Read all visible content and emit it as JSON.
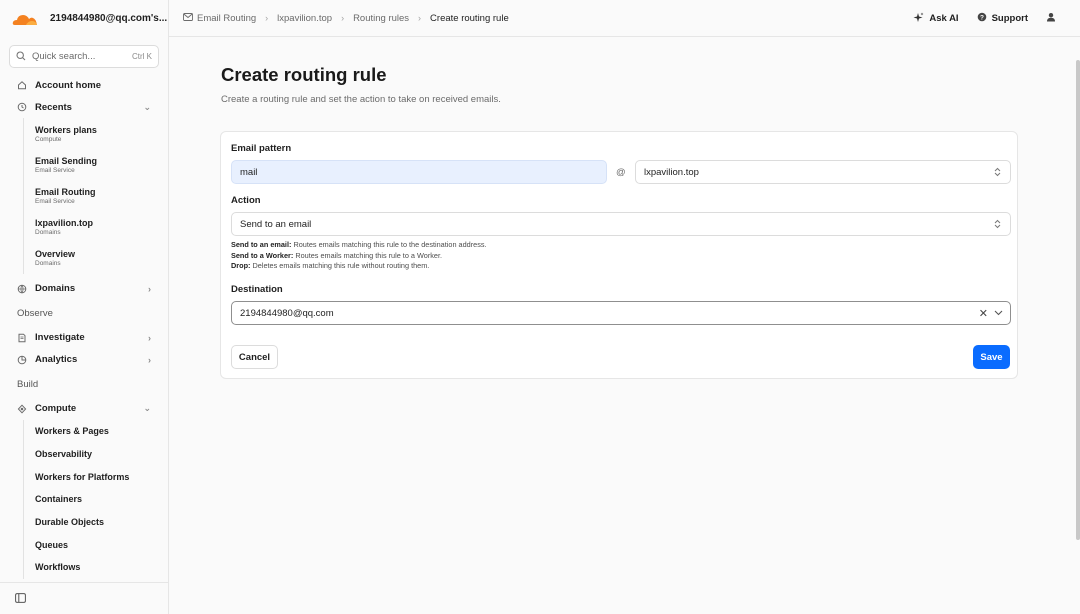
{
  "account": {
    "name": "2194844980@qq.com's..."
  },
  "search": {
    "placeholder": "Quick search...",
    "shortcut": "Ctrl K"
  },
  "sidebar": {
    "account_home": "Account home",
    "recents": {
      "label": "Recents",
      "items": [
        {
          "title": "Workers plans",
          "subtitle": "Compute"
        },
        {
          "title": "Email Sending",
          "subtitle": "Email Service"
        },
        {
          "title": "Email Routing",
          "subtitle": "Email Service"
        },
        {
          "title": "lxpavilion.top",
          "subtitle": "Domains"
        },
        {
          "title": "Overview",
          "subtitle": "Domains"
        }
      ]
    },
    "domains": "Domains",
    "observe_label": "Observe",
    "investigate": "Investigate",
    "analytics": "Analytics",
    "build_label": "Build",
    "compute": {
      "label": "Compute",
      "items": [
        "Workers & Pages",
        "Observability",
        "Workers for Platforms",
        "Containers",
        "Durable Objects",
        "Queues",
        "Workflows"
      ]
    }
  },
  "breadcrumb": [
    "Email Routing",
    "lxpavilion.top",
    "Routing rules",
    "Create routing rule"
  ],
  "topbar": {
    "ask_ai": "Ask AI",
    "support": "Support"
  },
  "page": {
    "title": "Create routing rule",
    "subtitle": "Create a routing rule and set the action to take on received emails."
  },
  "form": {
    "email_pattern_label": "Email pattern",
    "email_pattern_value": "mail",
    "at_symbol": "@",
    "domain_value": "lxpavilion.top",
    "action_label": "Action",
    "action_value": "Send to an email",
    "help": [
      {
        "term": "Send to an email:",
        "text": " Routes emails matching this rule to the destination address."
      },
      {
        "term": "Send to a Worker:",
        "text": " Routes emails matching this rule to a Worker."
      },
      {
        "term": "Drop:",
        "text": " Deletes emails matching this rule without routing them."
      }
    ],
    "destination_label": "Destination",
    "destination_value": "2194844980@qq.com",
    "cancel_label": "Cancel",
    "save_label": "Save"
  },
  "colors": {
    "accent": "#0a6cff",
    "brand_orange": "#f48120",
    "filled_input": "#e8f0fe"
  }
}
